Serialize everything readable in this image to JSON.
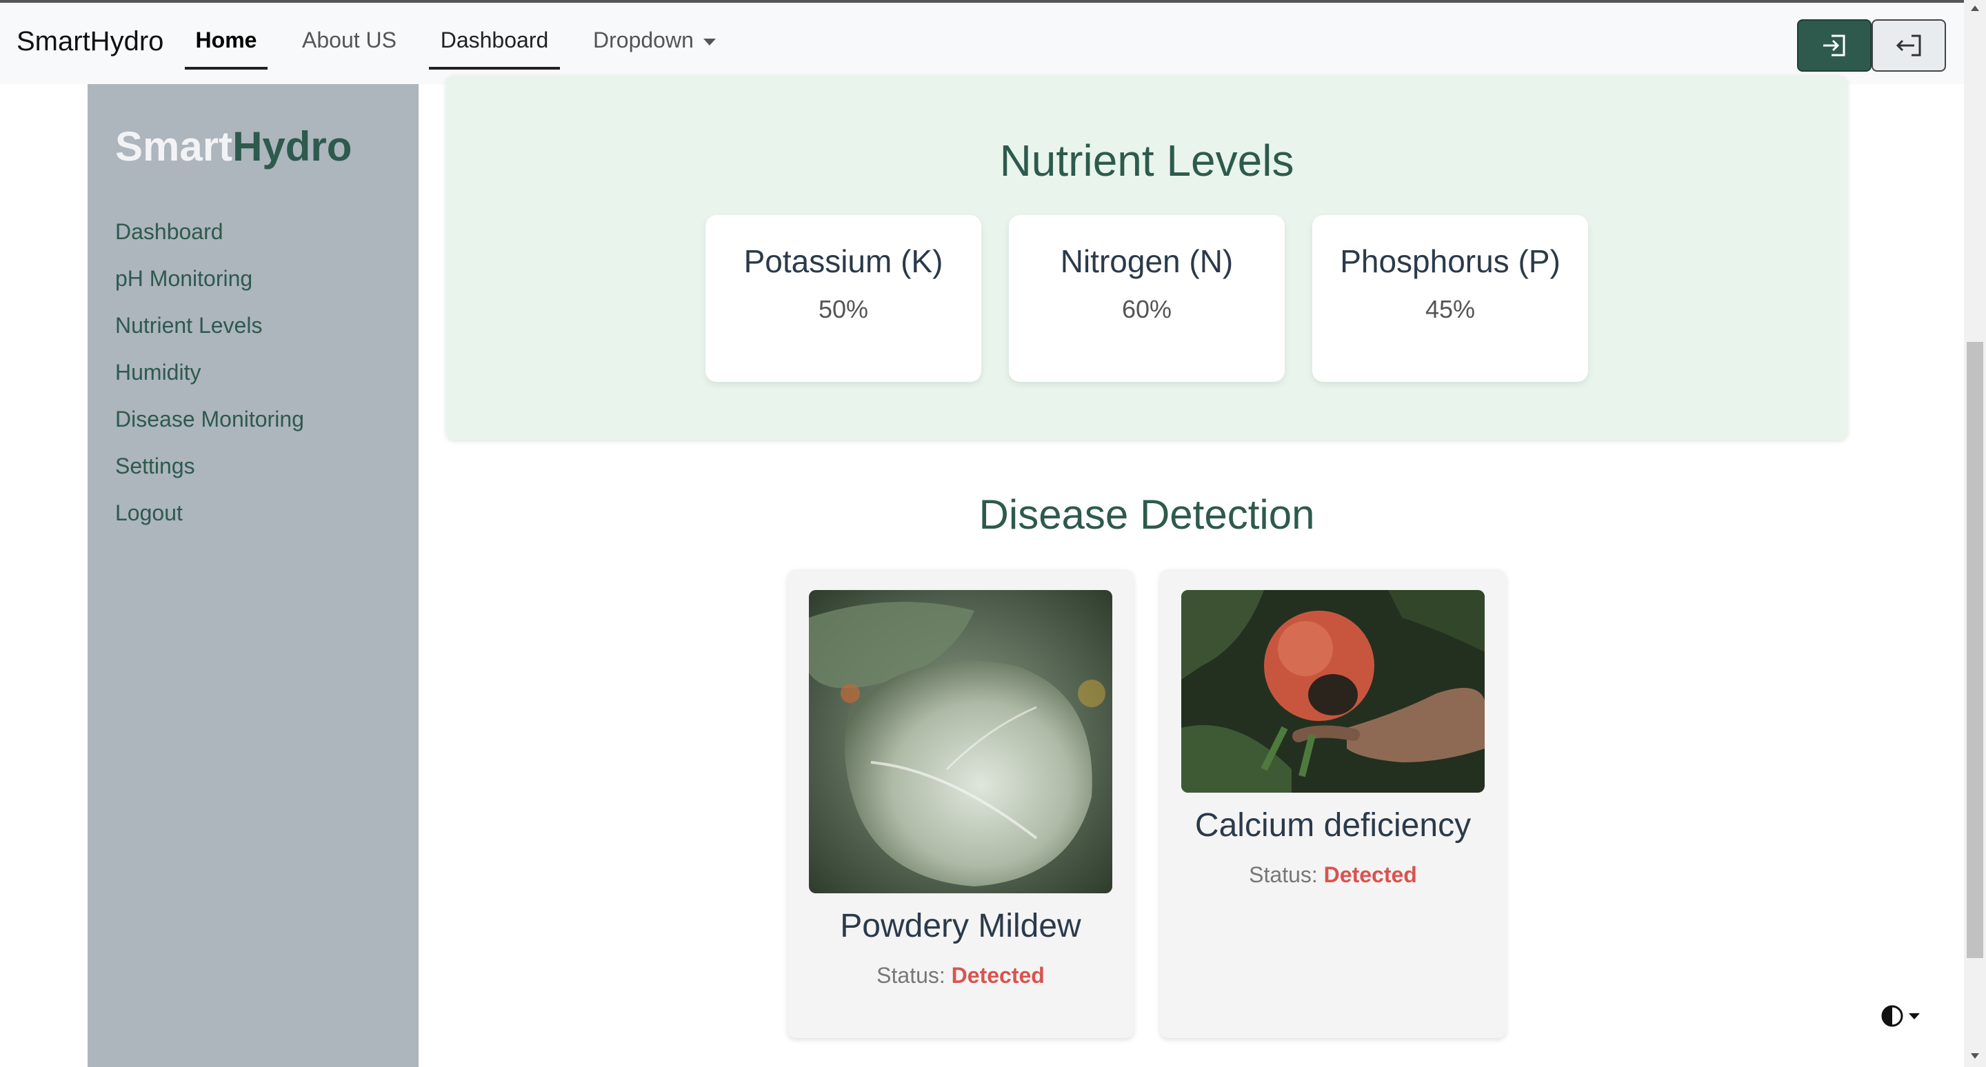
{
  "navbar": {
    "brand": "SmartHydro",
    "links": [
      {
        "label": "Home"
      },
      {
        "label": "About US"
      },
      {
        "label": "Dashboard"
      },
      {
        "label": "Dropdown"
      }
    ],
    "login_icon": "login-icon",
    "logout_icon": "logout-icon",
    "accent": "#2d5a4d"
  },
  "sidebar": {
    "brand_light": "Smart",
    "brand_dark": "Hydro",
    "items": [
      {
        "label": "Dashboard"
      },
      {
        "label": "pH Monitoring"
      },
      {
        "label": "Nutrient Levels"
      },
      {
        "label": "Humidity"
      },
      {
        "label": "Disease Monitoring"
      },
      {
        "label": "Settings"
      },
      {
        "label": "Logout"
      }
    ]
  },
  "nutrients": {
    "title": "Nutrient Levels",
    "cards": [
      {
        "name": "Potassium (K)",
        "value": "50%"
      },
      {
        "name": "Nitrogen (N)",
        "value": "60%"
      },
      {
        "name": "Phosphorus (P)",
        "value": "45%"
      }
    ]
  },
  "disease": {
    "title": "Disease Detection",
    "status_label": "Status:",
    "cards": [
      {
        "name": "Powdery Mildew",
        "status": "Detected",
        "image": "powdery-mildew-leaf-photo"
      },
      {
        "name": "Calcium deficiency",
        "status": "Detected",
        "image": "tomato-blossom-end-rot-photo"
      }
    ],
    "status_color": "#d9534f"
  },
  "theme_toggle_icon": "contrast-icon"
}
